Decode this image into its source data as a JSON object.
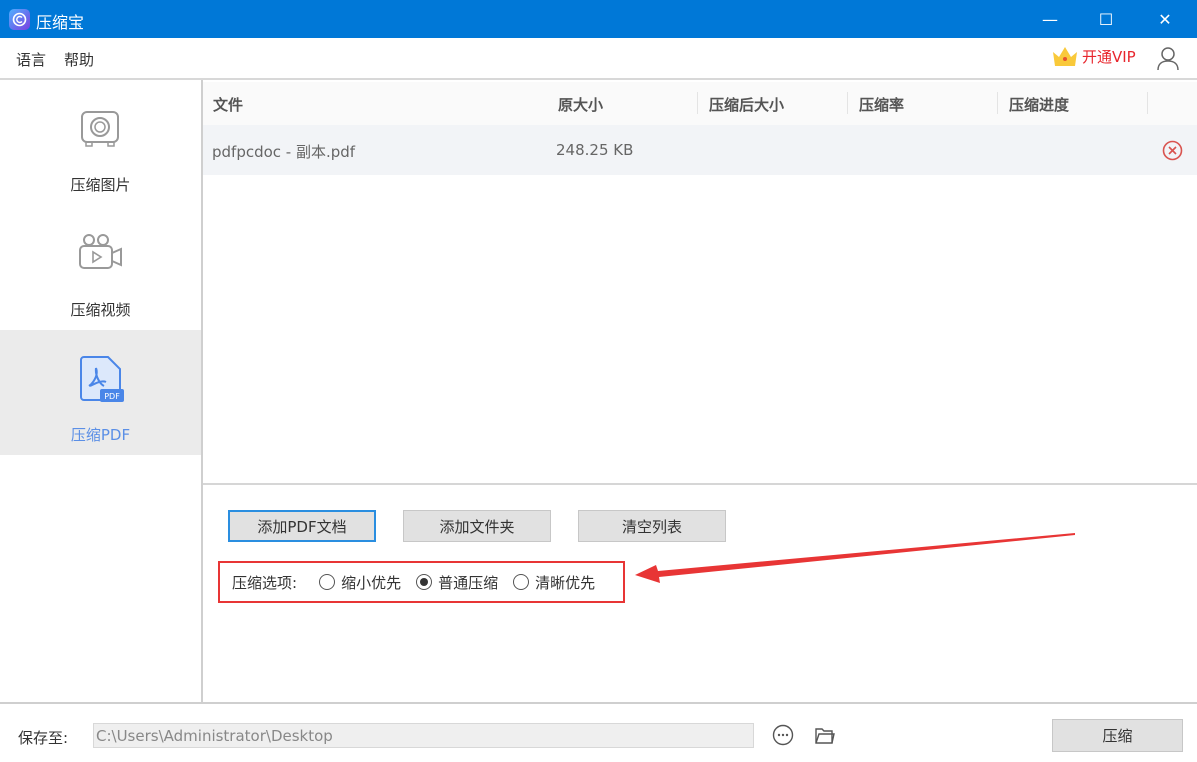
{
  "window": {
    "title": "压缩宝",
    "minimize": "—",
    "maximize": "☐",
    "close": "✕"
  },
  "menu": {
    "language": "语言",
    "help": "帮助",
    "vip": "开通VIP"
  },
  "sidebar": {
    "items": [
      {
        "label": "压缩图片"
      },
      {
        "label": "压缩视频"
      },
      {
        "label": "压缩PDF",
        "active": true
      }
    ]
  },
  "table": {
    "headers": [
      "文件",
      "原大小",
      "压缩后大小",
      "压缩率",
      "压缩进度"
    ],
    "rows": [
      {
        "file": "pdfpcdoc - 副本.pdf",
        "size": "248.25 KB",
        "compressed": "",
        "rate": "",
        "progress": ""
      }
    ]
  },
  "buttons": {
    "add_pdf": "添加PDF文档",
    "add_folder": "添加文件夹",
    "clear": "清空列表"
  },
  "options": {
    "label": "压缩选项:",
    "choices": [
      "缩小优先",
      "普通压缩",
      "清晰优先"
    ],
    "selected": "普通压缩"
  },
  "footer": {
    "save_label": "保存至:",
    "path": "C:\\Users\\Administrator\\Desktop",
    "compress": "压缩"
  },
  "colors": {
    "accent": "#0078d7",
    "highlight": "#e83535",
    "vip": "#e8262d",
    "active": "#5b8fe6"
  }
}
